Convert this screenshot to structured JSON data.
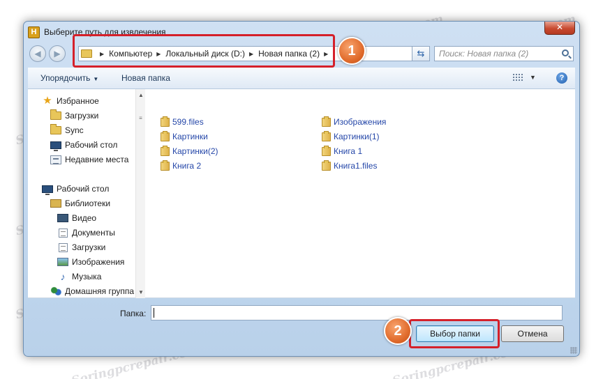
{
  "window": {
    "title": "Выберите путь для извлечения",
    "app_icon_letter": "H",
    "close_label": "✕"
  },
  "nav": {
    "back_glyph": "◀",
    "forward_glyph": "▶",
    "breadcrumbs": [
      "Компьютер",
      "Локальный диск (D:)",
      "Новая папка (2)"
    ],
    "search_placeholder": "Поиск: Новая папка (2)"
  },
  "toolbar": {
    "organize_label": "Упорядочить",
    "new_folder_label": "Новая папка",
    "help_label": "?"
  },
  "sidebar": {
    "favorites": {
      "label": "Избранное",
      "items": [
        "Загрузки",
        "Sync",
        "Рабочий стол",
        "Недавние места"
      ]
    },
    "desktop": {
      "label": "Рабочий стол",
      "libraries_label": "Библиотеки",
      "libraries": [
        "Видео",
        "Документы",
        "Загрузки",
        "Изображения",
        "Музыка"
      ],
      "homegroup_label": "Домашняя группа"
    }
  },
  "files": {
    "column1": [
      "599.files",
      "Картинки",
      "Картинки(2)",
      "Книга 2"
    ],
    "column2": [
      "Изображения",
      "Картинки(1)",
      "Книга 1",
      "Книга1.files"
    ]
  },
  "footer": {
    "folder_label": "Папка:",
    "folder_value": "",
    "select_button": "Выбор папки",
    "cancel_button": "Отмена"
  },
  "callouts": [
    "1",
    "2"
  ],
  "watermark_text": "Soringpcrepair.com",
  "colors": {
    "callout_border": "#d5202a",
    "callout_fill": "#e16c2d",
    "link_text": "#2446a8",
    "folder": "#e8c65a"
  }
}
